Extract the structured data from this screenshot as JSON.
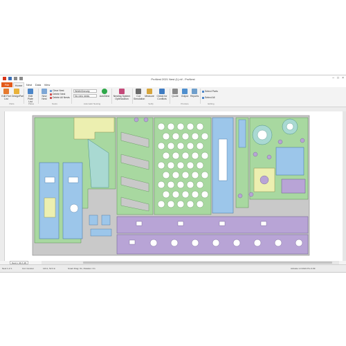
{
  "window": {
    "title": "ProNest 2021 Nest (1).nif - ProNest"
  },
  "tabs": [
    {
      "label": "File"
    },
    {
      "label": "Home"
    },
    {
      "label": "Nest"
    },
    {
      "label": "Data"
    },
    {
      "label": "View"
    }
  ],
  "ribbon": {
    "edit_part": "Edit Part List",
    "design_part": "DesignPart",
    "edit_plate": "Edit Plate List",
    "new_nest": "New Nest",
    "clear_nest": "Clear Nest",
    "delete_nest": "Delete Nest",
    "delete_all": "Delete All Nests",
    "strategy_value": "Width/Density",
    "strategy_sub": "No new nests",
    "autonest": "AutoNest",
    "nesting_opt": "Nesting System Optimization",
    "cut_sim": "Cut Simulation",
    "measure": "Measure",
    "check_conflicts": "Check for Conflicts",
    "quote": "Quote",
    "output": "Output",
    "reports": "Reports",
    "select_parts": "Select Parts",
    "select_all": "Select All",
    "groups": [
      "Parts",
      "Plates",
      "Nests",
      "Automatic Nesting",
      "Verify",
      "Produce",
      "Editing"
    ]
  },
  "sheet_tab": "Nest 1: 96 X 48",
  "status": {
    "nest": "Nest 1 of 1",
    "cut": "Cut: Contour",
    "coords": "123.1, 52.3 in",
    "info": "Smart Drag: On, Rotation: On",
    "license": "Activate 1.0 2021 Pro 3.99"
  },
  "colors": {
    "file_tab": "#e35a1a",
    "plate": "#c9c9c9",
    "green": "#a8d8a0",
    "blue": "#9cc6ea",
    "purple": "#b8a4d6",
    "yellow": "#ecefb0",
    "teal": "#a9d9d2"
  }
}
